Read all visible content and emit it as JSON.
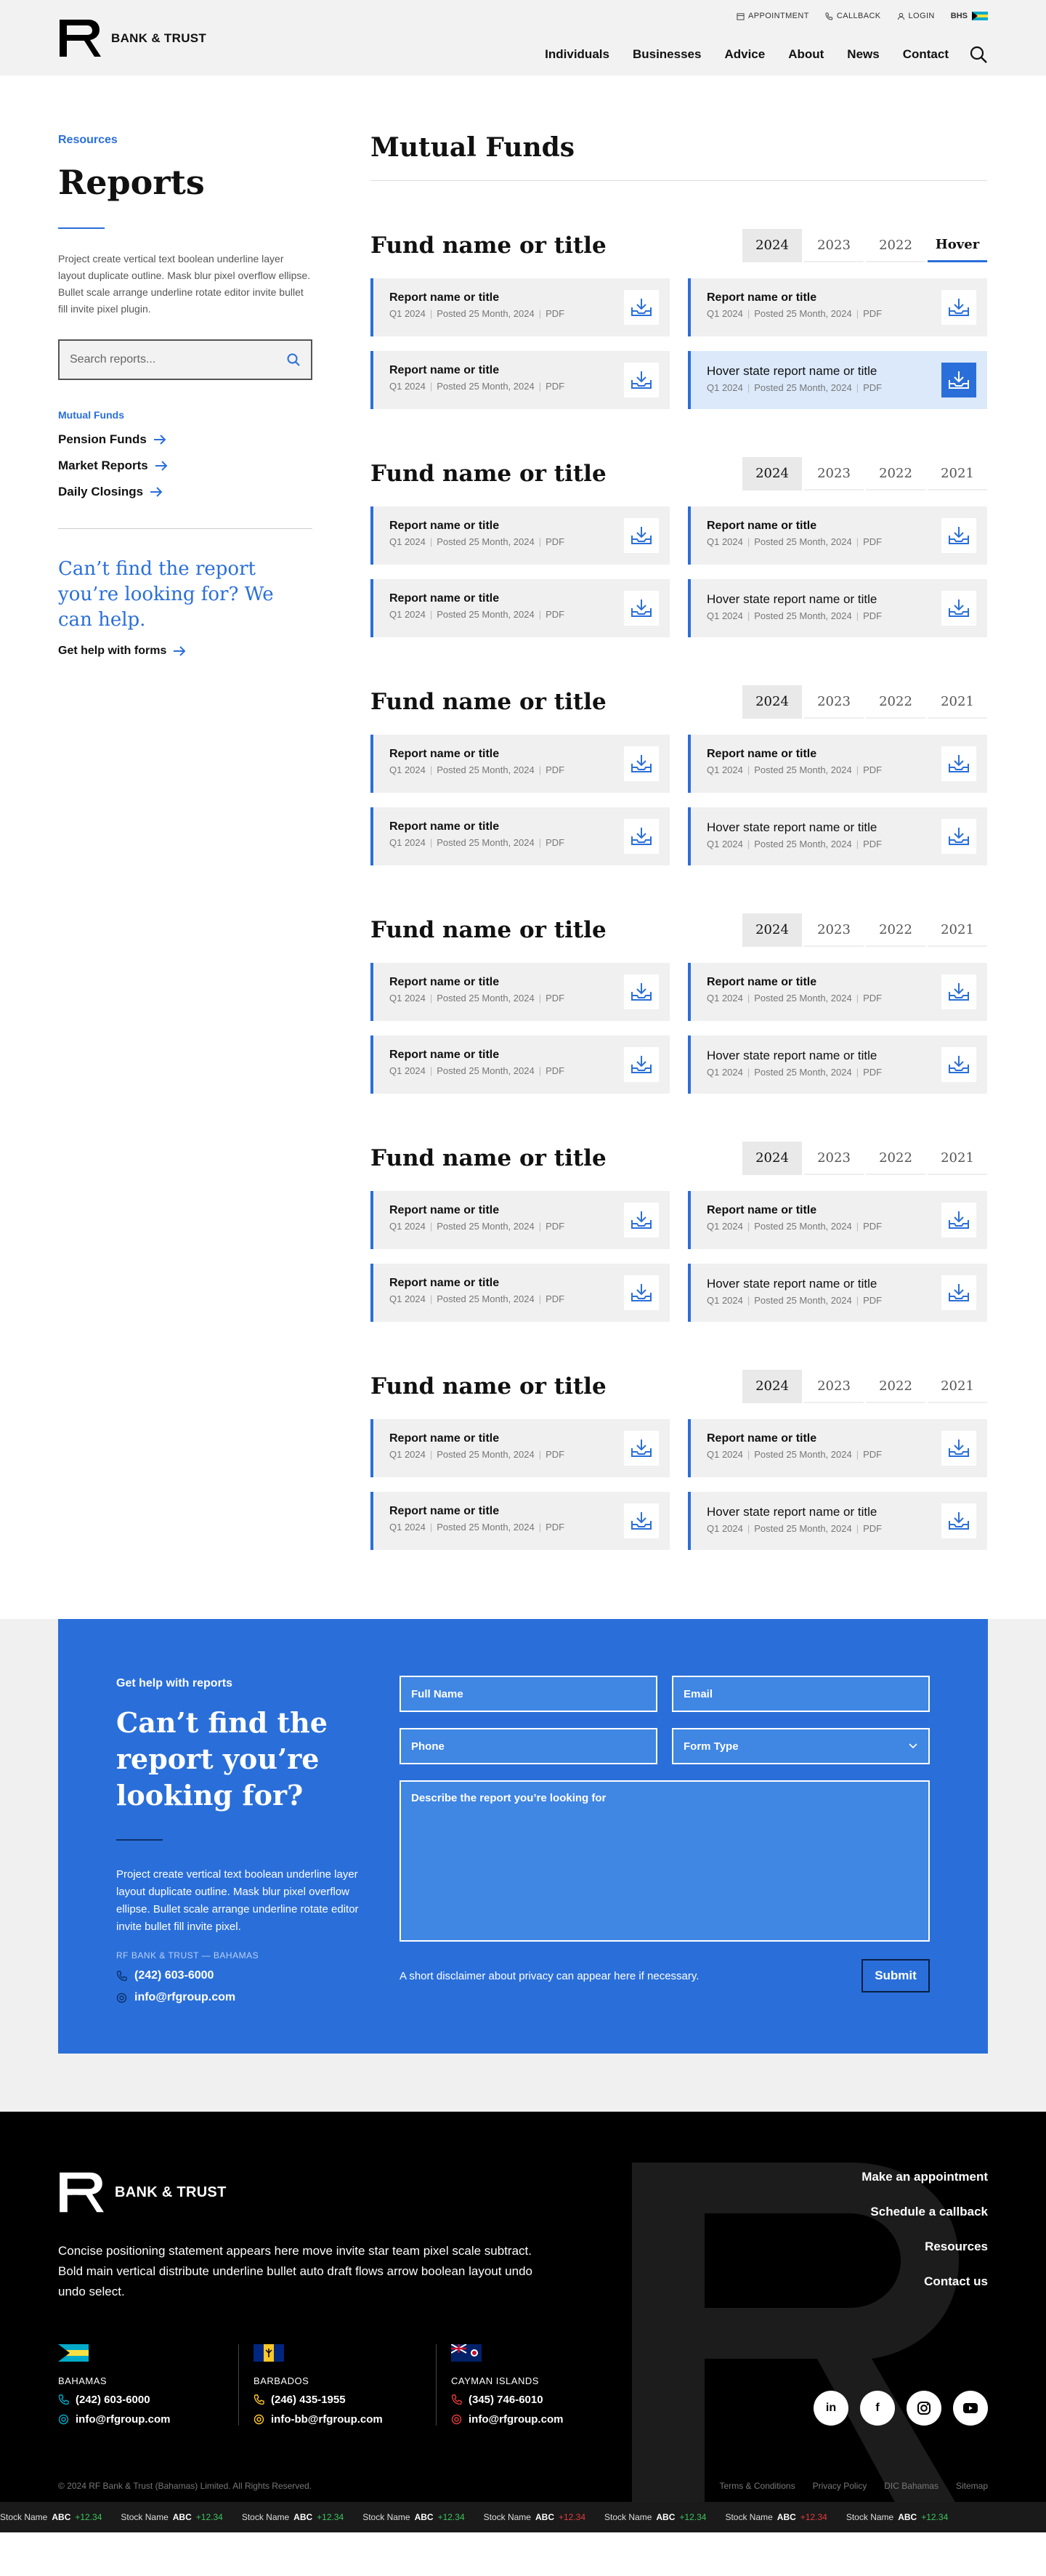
{
  "header": {
    "brand": "BANK & TRUST",
    "utility": {
      "appointment": "APPOINTMENT",
      "callback": "CALLBACK",
      "login": "LOGIN",
      "region": "BHS"
    },
    "nav": [
      "Individuals",
      "Businesses",
      "Advice",
      "About",
      "News",
      "Contact"
    ]
  },
  "sidebar": {
    "breadcrumb": "Resources",
    "title": "Reports",
    "description": "Project create vertical text boolean underline layer layout duplicate outline. Mask blur pixel overflow ellipse. Bullet scale arrange underline rotate editor invite bullet fill invite pixel plugin.",
    "search_placeholder": "Search reports...",
    "subheading": "Mutual Funds",
    "links": [
      "Pension Funds",
      "Market Reports",
      "Daily Closings"
    ],
    "help_question": "Can’t find the report you’re looking for? We can help.",
    "help_link": "Get help with forms"
  },
  "content": {
    "title": "Mutual Funds",
    "funds": [
      {
        "title": "Fund name or title",
        "tabs": [
          "2024",
          "2023",
          "2022",
          "Hover"
        ],
        "cards": [
          {
            "title": "Report name or title",
            "quarter": "Q1 2024",
            "posted": "Posted 25 Month, 2024",
            "type": "PDF"
          },
          {
            "title": "Report name or title",
            "quarter": "Q1 2024",
            "posted": "Posted 25 Month, 2024",
            "type": "PDF"
          },
          {
            "title": "Report name or title",
            "quarter": "Q1 2024",
            "posted": "Posted 25 Month, 2024",
            "type": "PDF"
          },
          {
            "title": "Hover state report name or title",
            "quarter": "Q1 2024",
            "posted": "Posted 25 Month, 2024",
            "type": "PDF"
          }
        ]
      },
      {
        "title": "Fund name or title",
        "tabs": [
          "2024",
          "2023",
          "2022",
          "2021"
        ],
        "cards": [
          {
            "title": "Report name or title",
            "quarter": "Q1 2024",
            "posted": "Posted 25 Month, 2024",
            "type": "PDF"
          },
          {
            "title": "Report name or title",
            "quarter": "Q1 2024",
            "posted": "Posted 25 Month, 2024",
            "type": "PDF"
          },
          {
            "title": "Report name or title",
            "quarter": "Q1 2024",
            "posted": "Posted 25 Month, 2024",
            "type": "PDF"
          },
          {
            "title": "Hover state report name or title",
            "quarter": "Q1 2024",
            "posted": "Posted 25 Month, 2024",
            "type": "PDF"
          }
        ]
      },
      {
        "title": "Fund name or title",
        "tabs": [
          "2024",
          "2023",
          "2022",
          "2021"
        ],
        "cards": [
          {
            "title": "Report name or title",
            "quarter": "Q1 2024",
            "posted": "Posted 25 Month, 2024",
            "type": "PDF"
          },
          {
            "title": "Report name or title",
            "quarter": "Q1 2024",
            "posted": "Posted 25 Month, 2024",
            "type": "PDF"
          },
          {
            "title": "Report name or title",
            "quarter": "Q1 2024",
            "posted": "Posted 25 Month, 2024",
            "type": "PDF"
          },
          {
            "title": "Hover state report name or title",
            "quarter": "Q1 2024",
            "posted": "Posted 25 Month, 2024",
            "type": "PDF"
          }
        ]
      },
      {
        "title": "Fund name or title",
        "tabs": [
          "2024",
          "2023",
          "2022",
          "2021"
        ],
        "cards": [
          {
            "title": "Report name or title",
            "quarter": "Q1 2024",
            "posted": "Posted 25 Month, 2024",
            "type": "PDF"
          },
          {
            "title": "Report name or title",
            "quarter": "Q1 2024",
            "posted": "Posted 25 Month, 2024",
            "type": "PDF"
          },
          {
            "title": "Report name or title",
            "quarter": "Q1 2024",
            "posted": "Posted 25 Month, 2024",
            "type": "PDF"
          },
          {
            "title": "Hover state report name or title",
            "quarter": "Q1 2024",
            "posted": "Posted 25 Month, 2024",
            "type": "PDF"
          }
        ]
      },
      {
        "title": "Fund name or title",
        "tabs": [
          "2024",
          "2023",
          "2022",
          "2021"
        ],
        "cards": [
          {
            "title": "Report name or title",
            "quarter": "Q1 2024",
            "posted": "Posted 25 Month, 2024",
            "type": "PDF"
          },
          {
            "title": "Report name or title",
            "quarter": "Q1 2024",
            "posted": "Posted 25 Month, 2024",
            "type": "PDF"
          },
          {
            "title": "Report name or title",
            "quarter": "Q1 2024",
            "posted": "Posted 25 Month, 2024",
            "type": "PDF"
          },
          {
            "title": "Hover state report name or title",
            "quarter": "Q1 2024",
            "posted": "Posted 25 Month, 2024",
            "type": "PDF"
          }
        ]
      },
      {
        "title": "Fund name or title",
        "tabs": [
          "2024",
          "2023",
          "2022",
          "2021"
        ],
        "cards": [
          {
            "title": "Report name or title",
            "quarter": "Q1 2024",
            "posted": "Posted 25 Month, 2024",
            "type": "PDF"
          },
          {
            "title": "Report name or title",
            "quarter": "Q1 2024",
            "posted": "Posted 25 Month, 2024",
            "type": "PDF"
          },
          {
            "title": "Report name or title",
            "quarter": "Q1 2024",
            "posted": "Posted 25 Month, 2024",
            "type": "PDF"
          },
          {
            "title": "Hover state report name or title",
            "quarter": "Q1 2024",
            "posted": "Posted 25 Month, 2024",
            "type": "PDF"
          }
        ]
      }
    ]
  },
  "cta": {
    "kicker": "Get help with reports",
    "title": "Can’t find the report you’re looking for?",
    "description": "Project create vertical text boolean underline layer layout duplicate outline. Mask blur pixel overflow ellipse. Bullet scale arrange underline rotate editor invite bullet fill invite pixel.",
    "office_label": "RF BANK & TRUST — BAHAMAS",
    "phone": "(242) 603-6000",
    "email": "info@rfgroup.com",
    "form": {
      "full_name": "Full Name",
      "email": "Email",
      "phone": "Phone",
      "form_type": "Form Type",
      "describe": "Describe the report you’re looking for",
      "disclaimer": "A short disclaimer about privacy can appear here if necessary.",
      "submit": "Submit"
    }
  },
  "footer": {
    "brand": "BANK & TRUST",
    "statement": "Concise positioning statement appears here move invite star team pixel scale subtract. Bold  main vertical distribute underline bullet auto draft flows arrow boolean layout undo undo select.",
    "links": [
      "Make an appointment",
      "Schedule a callback",
      "Resources",
      "Contact us"
    ],
    "offices": [
      {
        "name": "BAHAMAS",
        "phone": "(242) 603-6000",
        "email": "info@rfgroup.com"
      },
      {
        "name": "BARBADOS",
        "phone": "(246) 435-1955",
        "email": "info-bb@rfgroup.com"
      },
      {
        "name": "CAYMAN ISLANDS",
        "phone": "(345) 746-6010",
        "email": "info@rfgroup.com"
      }
    ],
    "socials": [
      "linkedin-icon",
      "facebook-icon",
      "instagram-icon",
      "youtube-icon"
    ],
    "copyright": "© 2024 RF Bank & Trust (Bahamas) Limited. All Rights Reserved.",
    "legal": [
      "Terms & Conditions",
      "Privacy Policy",
      "DIC Bahamas",
      "Sitemap"
    ],
    "ticker": [
      {
        "name": "Stock Name",
        "symbol": "ABC",
        "change": "+12.34",
        "dir": "up"
      },
      {
        "name": "Stock Name",
        "symbol": "ABC",
        "change": "+12.34",
        "dir": "up"
      },
      {
        "name": "Stock Name",
        "symbol": "ABC",
        "change": "+12.34",
        "dir": "up"
      },
      {
        "name": "Stock Name",
        "symbol": "ABC",
        "change": "+12.34",
        "dir": "up"
      },
      {
        "name": "Stock Name",
        "symbol": "ABC",
        "change": "+12.34",
        "dir": "down"
      },
      {
        "name": "Stock Name",
        "symbol": "ABC",
        "change": "+12.34",
        "dir": "up"
      },
      {
        "name": "Stock Name",
        "symbol": "ABC",
        "change": "+12.34",
        "dir": "down"
      },
      {
        "name": "Stock Name",
        "symbol": "ABC",
        "change": "+12.34",
        "dir": "up"
      }
    ]
  },
  "colors": {
    "accent": "#2a6fd9",
    "hover_card": "#dbe9fb",
    "footer_bg": "#000000"
  }
}
